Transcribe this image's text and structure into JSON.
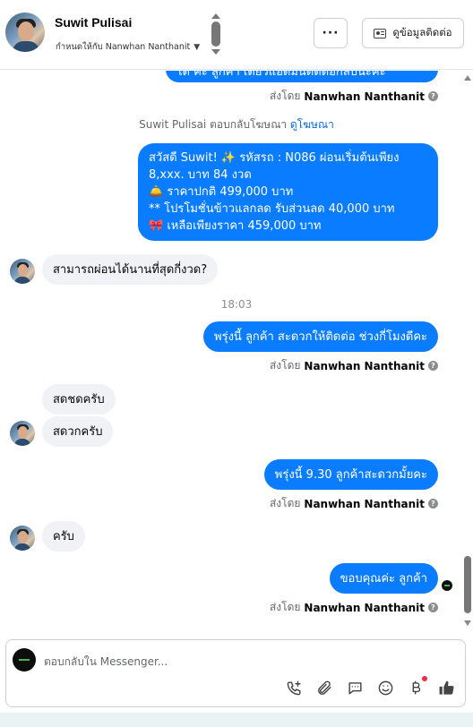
{
  "header": {
    "name": "Suwit Pulisai",
    "assigned": "กำหนดให้กับ Nanwhan Nanthanit",
    "more_label": "···",
    "contact_label": "ดูข้อมูลติดต่อ"
  },
  "chat": {
    "top_partial": "ได้ ค่ะ ลูกค้า เดี๋ยวแอดมินติดต่อกลับนะคะ",
    "sent_by_prefix": "ส่งโดย",
    "sent_by_name": "Nanwhan Nanthanit",
    "ad_notice": "Suwit Pulisai ตอบกลับโฆษณา",
    "ad_link": "ดูโฆษณา",
    "promo_lines": [
      "สวัสดี Suwit! ✨ รหัสรถ : N086 ผ่อนเริ่มต้นเพียง",
      "8,xxx. บาท 84 งวด",
      "🛎️ ราคาปกติ 499,000 บาท",
      "** โปรโมชั่นข้าวแลกลด รับส่วนลด 40,000 บาท",
      "🎀  เหลือเพียงราคา 459,000 บาท"
    ],
    "q_installment": "สามารถผ่อนได้นานที่สุดกี่งวด?",
    "time": "18:03",
    "out_tomorrow": "พรุ่งนี้ ลูกค้า สะดวกให้ติดต่อ ช่วงกี่โมงดีคะ",
    "in_1": "สดชดครับ",
    "in_2": "สดวกครับ",
    "out_930": "พรุ่งนี้ 9.30 ลูกค้าสะดวกมั้ยคะ",
    "in_3": "ครับ",
    "out_thanks": "ขอบคุณค่ะ  ลูกค้า"
  },
  "composer": {
    "placeholder": "ตอบกลับใน Messenger..."
  },
  "icons": {
    "call": "phone-add-icon",
    "attach": "paperclip-icon",
    "saved": "saved-reply-icon",
    "emoji": "emoji-icon",
    "pay": "baht-icon",
    "like": "thumbs-up-icon"
  },
  "colors": {
    "outgoing_bubble": "#0a7cff",
    "incoming_bubble": "#f0f2f5",
    "link": "#0a6ad8"
  }
}
